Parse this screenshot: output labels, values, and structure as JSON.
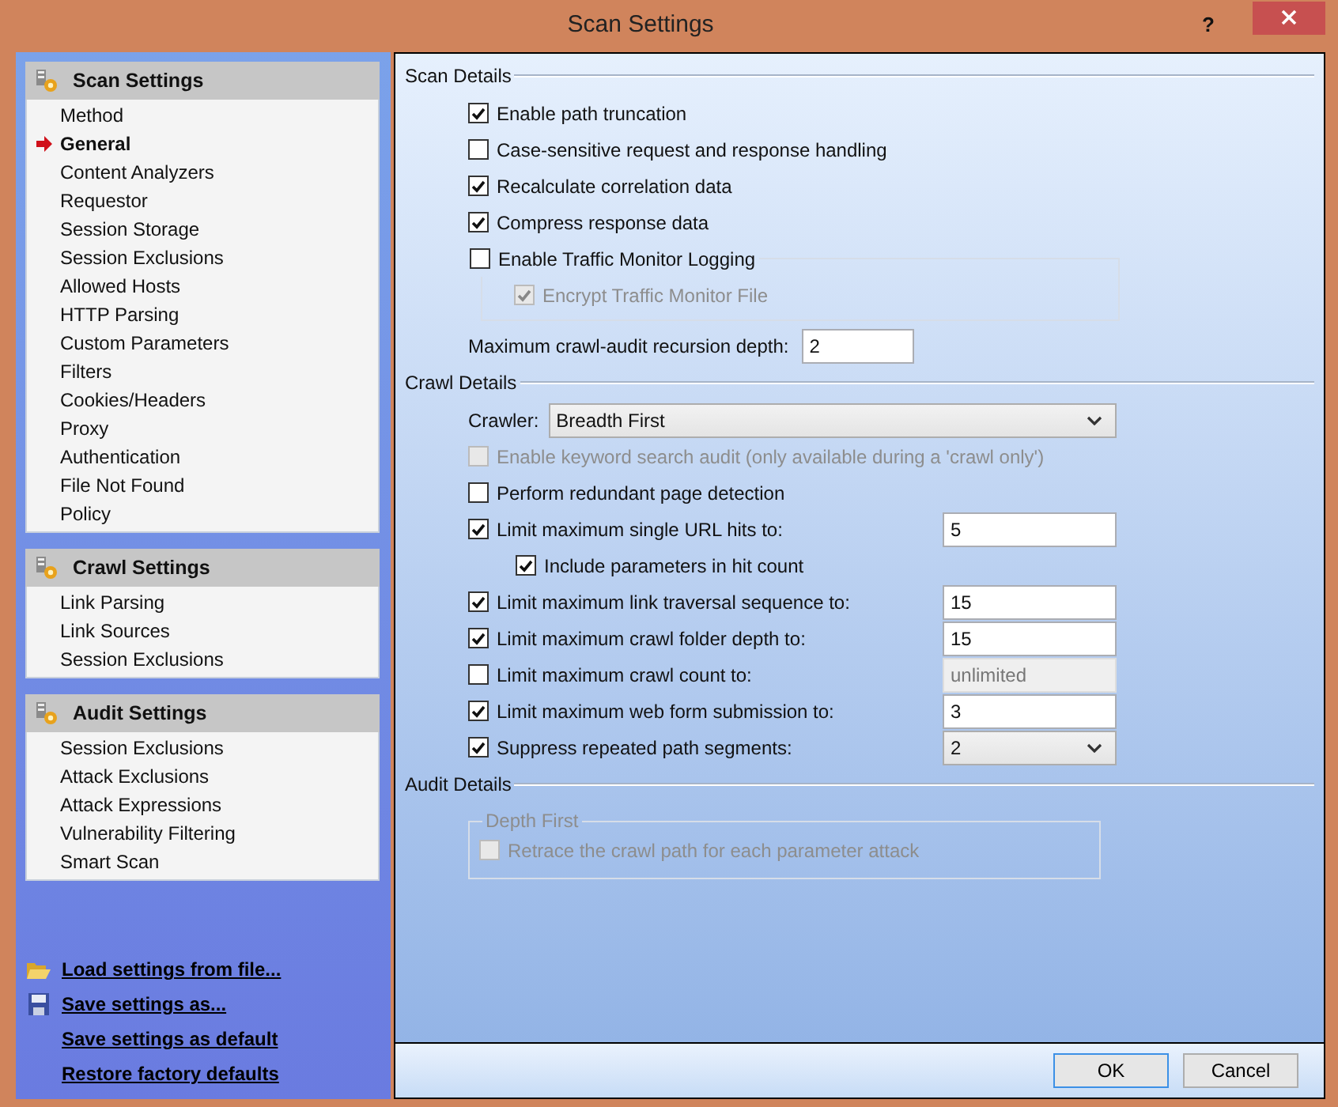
{
  "window": {
    "title": "Scan Settings",
    "help": "?"
  },
  "sidebar": {
    "sections": [
      {
        "title": "Scan Settings",
        "items": [
          {
            "label": "Method",
            "selected": false
          },
          {
            "label": "General",
            "selected": true
          },
          {
            "label": "Content Analyzers",
            "selected": false
          },
          {
            "label": "Requestor",
            "selected": false
          },
          {
            "label": "Session Storage",
            "selected": false
          },
          {
            "label": "Session Exclusions",
            "selected": false
          },
          {
            "label": "Allowed Hosts",
            "selected": false
          },
          {
            "label": "HTTP Parsing",
            "selected": false
          },
          {
            "label": "Custom Parameters",
            "selected": false
          },
          {
            "label": "Filters",
            "selected": false
          },
          {
            "label": "Cookies/Headers",
            "selected": false
          },
          {
            "label": "Proxy",
            "selected": false
          },
          {
            "label": "Authentication",
            "selected": false
          },
          {
            "label": "File Not Found",
            "selected": false
          },
          {
            "label": "Policy",
            "selected": false
          }
        ]
      },
      {
        "title": "Crawl Settings",
        "items": [
          {
            "label": "Link Parsing",
            "selected": false
          },
          {
            "label": "Link Sources",
            "selected": false
          },
          {
            "label": "Session Exclusions",
            "selected": false
          }
        ]
      },
      {
        "title": "Audit Settings",
        "items": [
          {
            "label": "Session Exclusions",
            "selected": false
          },
          {
            "label": "Attack Exclusions",
            "selected": false
          },
          {
            "label": "Attack Expressions",
            "selected": false
          },
          {
            "label": "Vulnerability Filtering",
            "selected": false
          },
          {
            "label": "Smart Scan",
            "selected": false
          }
        ]
      }
    ],
    "links": [
      {
        "kind": "load",
        "label": "Load settings from file..."
      },
      {
        "kind": "save",
        "label": "Save settings as..."
      },
      {
        "kind": "plain",
        "label": "Save settings as default"
      },
      {
        "kind": "plain",
        "label": "Restore factory defaults"
      }
    ]
  },
  "sections": [
    {
      "title": "Scan Details",
      "rows": [
        {
          "kind": "checkbox",
          "label": "Enable path truncation",
          "checked": true,
          "disabled": false
        },
        {
          "kind": "checkbox",
          "label": "Case-sensitive request and response handling",
          "checked": false,
          "disabled": false
        },
        {
          "kind": "checkbox",
          "label": "Recalculate correlation data",
          "checked": true,
          "disabled": false
        },
        {
          "kind": "checkbox",
          "label": "Compress response data",
          "checked": true,
          "disabled": false
        },
        {
          "kind": "checkgroup",
          "label": "Enable Traffic Monitor Logging",
          "checked": false,
          "disabled": false,
          "children": [
            {
              "kind": "checkbox",
              "label": "Encrypt Traffic Monitor File",
              "checked": true,
              "disabled": true
            }
          ]
        },
        {
          "kind": "field",
          "label": "Maximum crawl-audit recursion depth:",
          "value": "2"
        }
      ]
    },
    {
      "title": "Crawl Details",
      "rows": [
        {
          "kind": "select",
          "label": "Crawler:",
          "value": "Breadth First"
        },
        {
          "kind": "checkbox",
          "label": "Enable keyword search audit (only available during a 'crawl only')",
          "checked": false,
          "disabled": true
        },
        {
          "kind": "checkbox",
          "label": "Perform redundant page detection",
          "checked": false,
          "disabled": false
        },
        {
          "kind": "checkbox",
          "label": "Limit maximum single URL hits to:",
          "checked": true,
          "disabled": false,
          "input": {
            "value": "5",
            "disabled": false
          },
          "children": [
            {
              "kind": "checkbox",
              "label": "Include parameters in hit count",
              "checked": true,
              "disabled": false
            }
          ]
        },
        {
          "kind": "checkbox",
          "label": "Limit maximum link traversal sequence to:",
          "checked": true,
          "disabled": false,
          "input": {
            "value": "15",
            "disabled": false
          }
        },
        {
          "kind": "checkbox",
          "label": "Limit maximum crawl folder depth to:",
          "checked": true,
          "disabled": false,
          "input": {
            "value": "15",
            "disabled": false
          }
        },
        {
          "kind": "checkbox",
          "label": "Limit maximum crawl count to:",
          "checked": false,
          "disabled": false,
          "input": {
            "value": "unlimited",
            "disabled": true
          }
        },
        {
          "kind": "checkbox",
          "label": "Limit maximum web form submission to:",
          "checked": true,
          "disabled": false,
          "input": {
            "value": "3",
            "disabled": false
          }
        },
        {
          "kind": "checkbox",
          "label": "Suppress repeated path segments:",
          "checked": true,
          "disabled": false,
          "dropdown": {
            "value": "2"
          }
        }
      ]
    },
    {
      "title": "Audit Details",
      "rows": [
        {
          "kind": "group",
          "label": "Depth First",
          "disabled": true,
          "children": [
            {
              "kind": "checkbox",
              "label": "Retrace the crawl path for each parameter attack",
              "checked": false,
              "disabled": true
            }
          ]
        }
      ]
    }
  ],
  "buttons": [
    {
      "label": "OK",
      "default": true
    },
    {
      "label": "Cancel",
      "default": false
    }
  ]
}
